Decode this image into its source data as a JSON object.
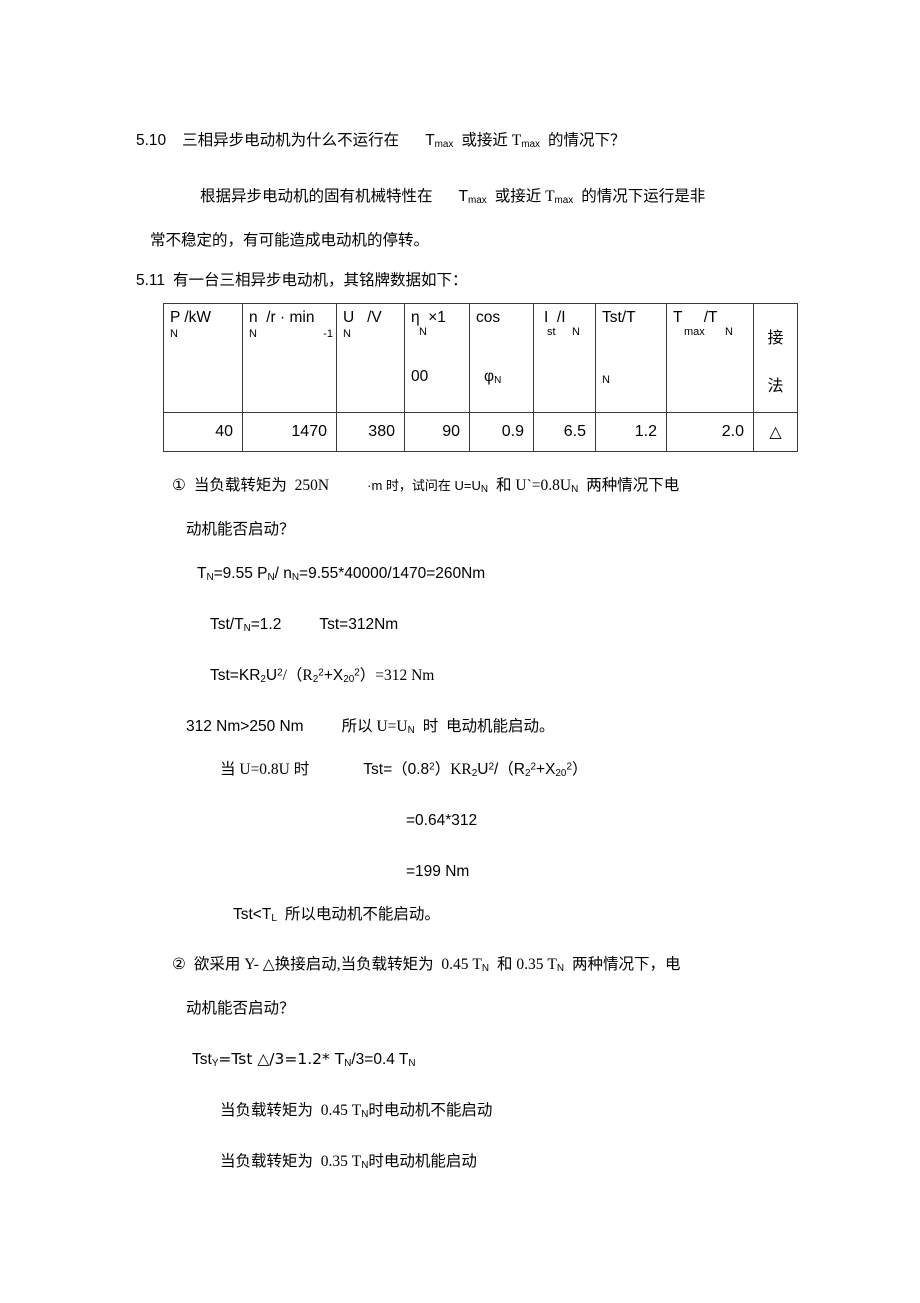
{
  "document": {
    "problem_510": {
      "number": "5.10",
      "question_prefix": "三相异步电动机为什么不运行在",
      "question_sym1": "T",
      "question_sym1_sub": "max",
      "question_mid": "或接近 T",
      "question_sym2_sub": "max",
      "question_suffix": "的情况下？",
      "answer_line1_a": "根据异步电动机的固有机械特性在",
      "answer_line1_b": "T",
      "answer_line1_b_sub": "max",
      "answer_line1_c": "或接近 T",
      "answer_line1_d_sub": "max",
      "answer_line1_e": "的情况下运行是非",
      "answer_line2": "常不稳定的，有可能造成电动机的停转。"
    },
    "problem_511": {
      "number": "5.11",
      "title": "有一台三相异步电动机，其铭牌数据如下：",
      "table": {
        "headers": [
          {
            "main": "P /kW",
            "sub": "N",
            "second": ""
          },
          {
            "main": "n  /r · min",
            "sub": "N",
            "sup": "-1",
            "second": ""
          },
          {
            "main": "U   /V",
            "sub": "N",
            "second": ""
          },
          {
            "main": "η  ×1",
            "sub": "N",
            "second": "00"
          },
          {
            "main": "cos",
            "second": "φ",
            "second_sub": "N"
          },
          {
            "main": "I  /I",
            "sub1": "st",
            "sub2": "N",
            "second": ""
          },
          {
            "main": "Tst/T",
            "second": "N"
          },
          {
            "main": "T     /T",
            "sub1": "max",
            "sub2": "N",
            "second": ""
          },
          {
            "cjk_a": "接",
            "cjk_b": "法"
          }
        ],
        "values": [
          "40",
          "1470",
          "380",
          "90",
          "0.9",
          "6.5",
          "1.2",
          "2.0",
          "△"
        ]
      },
      "part1": {
        "marker": "①",
        "line1_a": "当负载转矩为  250N",
        "line1_b": "·m 时，试问在 U=U",
        "line1_b_sub": "N",
        "line1_c": "和 U`=0.8U",
        "line1_c_sub": "N",
        "line1_d": "两种情况下电",
        "line2": "动机能否启动？",
        "calc1_a": "T",
        "calc1_a_sub": "N",
        "calc1_b": "=9.55 P",
        "calc1_b_sub": "N",
        "calc1_c": "/ n",
        "calc1_c_sub": "N",
        "calc1_d": "=9.55*40000/1470=260Nm",
        "calc2_a": "Tst/T",
        "calc2_a_sub": "N",
        "calc2_b": "=1.2",
        "calc2_c": "Tst=312Nm",
        "calc3_a": "Tst=KR",
        "calc3_a_sub": "2",
        "calc3_b": "U",
        "calc3_b_sup": "2",
        "calc3_c": "/（R",
        "calc3_c_sub": "2",
        "calc3_c_sup": "2",
        "calc3_d": "+X",
        "calc3_d_sub": "20",
        "calc3_d_sup": "2",
        "calc3_e": "）=312 Nm",
        "calc4_a": "312 Nm>250 Nm",
        "calc4_b": "所以 U=U",
        "calc4_b_sub": "N",
        "calc4_c": "时  电动机能启动。",
        "calc5_a": "当 U=0.8U 时",
        "calc5_b": "Tst=（0.8",
        "calc5_b_sup": "2",
        "calc5_c": "）KR",
        "calc5_c_sub": "2",
        "calc5_d": "U",
        "calc5_d_sup": "2",
        "calc5_e": "/（R",
        "calc5_e_sub": "2",
        "calc5_e_sup": "2",
        "calc5_f": "+X",
        "calc5_f_sub": "20",
        "calc5_f_sup": "2",
        "calc5_g": "）",
        "calc6": "=0.64*312",
        "calc7": "=199 Nm",
        "calc8_a": "Tst<T",
        "calc8_a_sub": "L",
        "calc8_b": "所以电动机不能启动。"
      },
      "part2": {
        "marker": "②",
        "line1_a": "欲采用 Y- △换接启动,当负载转矩为  0.45 T",
        "line1_a_sub": "N",
        "line1_b": "和 0.35 T",
        "line1_b_sub": "N",
        "line1_c": "两种情况下，电",
        "line2": "动机能否启动？",
        "calc1_a": "Tst",
        "calc1_a_sub": "Y",
        "calc1_b": "=Tst △/3=1.2* T",
        "calc1_b_sub": "N",
        "calc1_c": "/3=0.4 T",
        "calc1_c_sub": "N",
        "result1_a": "当负载转矩为  0.45 T",
        "result1_a_sub": "N",
        "result1_b": "时电动机不能启动",
        "result2_a": "当负载转矩为  0.35 T",
        "result2_a_sub": "N",
        "result2_b": "时电动机能启动"
      }
    }
  }
}
